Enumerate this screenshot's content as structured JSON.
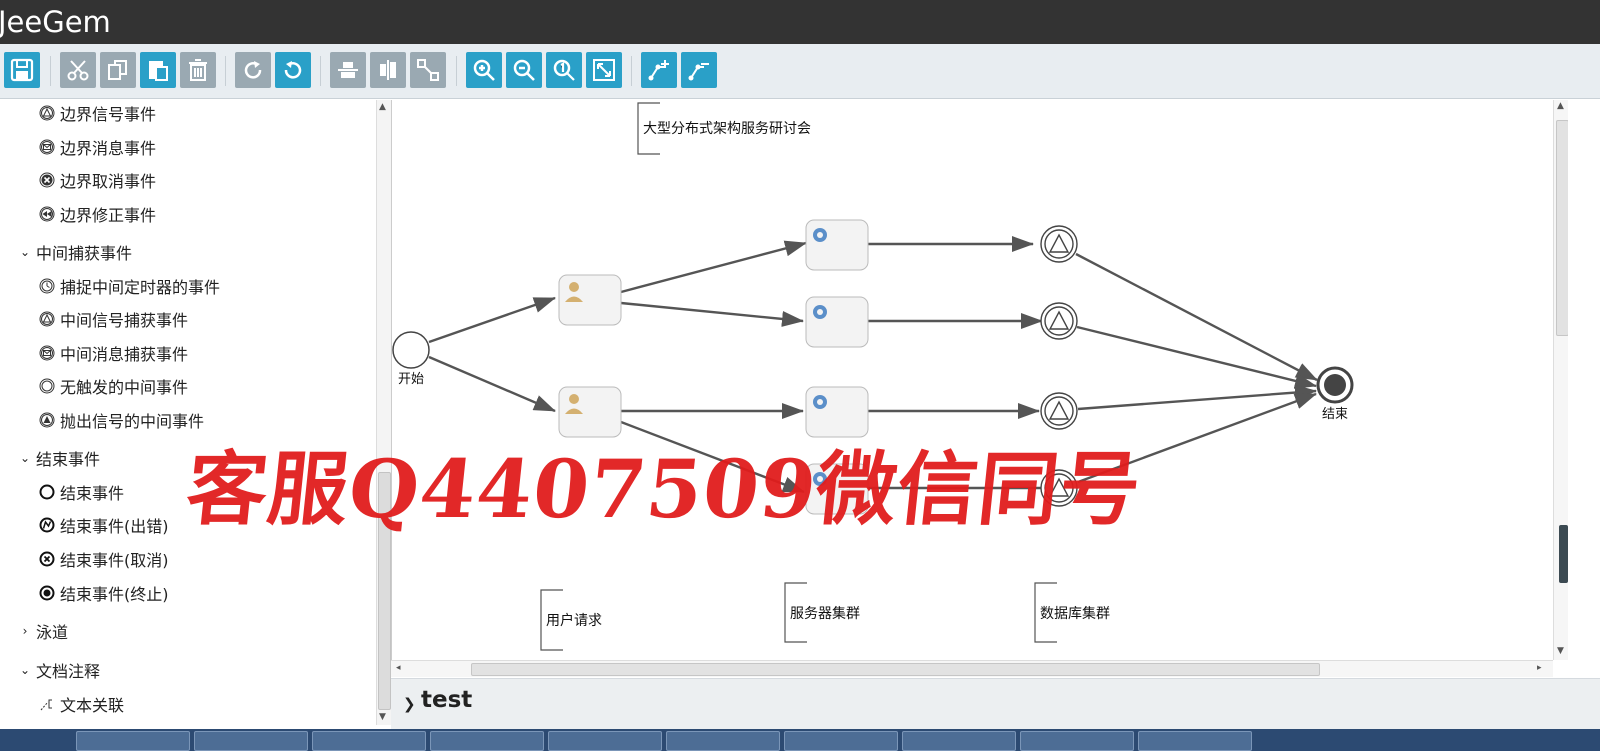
{
  "app": {
    "title": "JeeGem"
  },
  "toolbar": {
    "buttons": [
      {
        "name": "save-button",
        "icon": "save-icon"
      },
      {
        "name": "cut-button",
        "icon": "cut-icon"
      },
      {
        "name": "copy-button",
        "icon": "copy-icon"
      },
      {
        "name": "paste-button",
        "icon": "paste-icon"
      },
      {
        "name": "delete-button",
        "icon": "trash-icon"
      },
      {
        "name": "redo-button",
        "icon": "redo-icon"
      },
      {
        "name": "undo-button",
        "icon": "undo-icon"
      },
      {
        "name": "align-horizontal-button",
        "icon": "align-horizontal-icon"
      },
      {
        "name": "align-vertical-button",
        "icon": "align-vertical-icon"
      },
      {
        "name": "same-size-button",
        "icon": "resize-icon"
      },
      {
        "name": "zoom-in-button",
        "icon": "zoom-in-icon"
      },
      {
        "name": "zoom-out-button",
        "icon": "zoom-out-icon"
      },
      {
        "name": "zoom-actual-button",
        "icon": "zoom-actual-icon"
      },
      {
        "name": "zoom-fit-button",
        "icon": "fit-icon"
      },
      {
        "name": "add-bendpoint-button",
        "icon": "bendpoint-add-icon"
      },
      {
        "name": "remove-bendpoint-button",
        "icon": "bendpoint-remove-icon"
      }
    ]
  },
  "palette": {
    "items": [
      {
        "label": "边界信号事件",
        "icon": "boundary-signal-icon"
      },
      {
        "label": "边界消息事件",
        "icon": "boundary-message-icon"
      },
      {
        "label": "边界取消事件",
        "icon": "boundary-cancel-icon"
      },
      {
        "label": "边界修正事件",
        "icon": "boundary-compensate-icon"
      }
    ],
    "group_intermediate": "中间捕获事件",
    "intermediate_items": [
      {
        "label": "捕捉中间定时器的事件",
        "icon": "timer-icon"
      },
      {
        "label": "中间信号捕获事件",
        "icon": "signal-icon"
      },
      {
        "label": "中间消息捕获事件",
        "icon": "message-icon"
      },
      {
        "label": "无触发的中间事件",
        "icon": "none-event-icon"
      },
      {
        "label": "抛出信号的中间事件",
        "icon": "throw-signal-icon"
      }
    ],
    "group_end": "结束事件",
    "end_items": [
      {
        "label": "结束事件",
        "icon": "end-event-icon"
      },
      {
        "label": "结束事件(出错)",
        "icon": "end-error-icon"
      },
      {
        "label": "结束事件(取消)",
        "icon": "end-cancel-icon"
      },
      {
        "label": "结束事件(终止)",
        "icon": "end-terminate-icon"
      }
    ],
    "group_lane": "泳道",
    "group_annotation": "文档注释",
    "annotation_items": [
      {
        "label": "文本关联",
        "icon": "association-icon"
      }
    ]
  },
  "diagram": {
    "annotations": [
      "大型分布式架构服务研讨会",
      "用户请求",
      "服务器集群",
      "数据库集群"
    ],
    "start_label": "开始",
    "end_label": "结束"
  },
  "props": {
    "name": "test"
  },
  "watermark": "客服Q4407509微信同号",
  "colors": {
    "accent": "#2aa0c8",
    "disabled": "#9aa9b2",
    "titlebar": "#333333"
  }
}
